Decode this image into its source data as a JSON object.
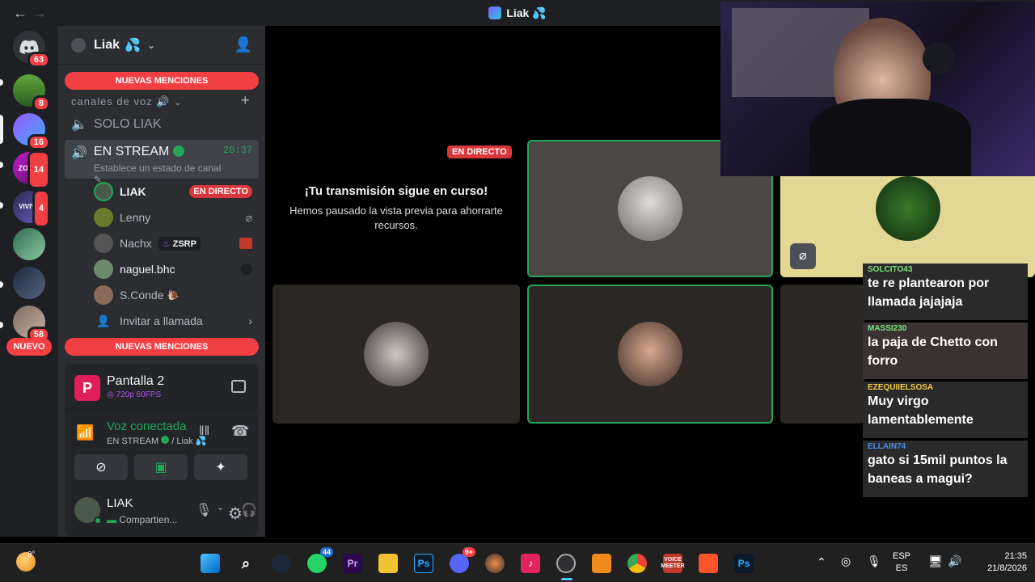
{
  "window": {
    "title": "Liak",
    "title_emoji": "💦"
  },
  "rail": {
    "home_badge": "63",
    "servers": [
      {
        "badge": "8"
      },
      {
        "badge": "16"
      },
      {
        "badge": "14",
        "label": "ZOOM"
      },
      {
        "badge": "4",
        "label": "VIVIVA"
      },
      {
        "badge": ""
      },
      {
        "badge": ""
      },
      {
        "badge": "58"
      }
    ],
    "new_pill": "NUEVO"
  },
  "server": {
    "name": "Liak",
    "name_emoji": "💦"
  },
  "channels": {
    "mentions_top": "NUEVAS MENCIONES",
    "mentions_bottom": "NUEVAS MENCIONES",
    "voice_category": "canales de voz",
    "solo_channel": "SOLO LIAK",
    "stream_channel": "EN STREAM",
    "stream_time": "28:37",
    "stream_status": "Establece un estado de canal",
    "users": [
      {
        "name": "LIAK",
        "badge": "EN DIRECTO"
      },
      {
        "name": "Lenny"
      },
      {
        "name": "Nachx",
        "tag": "ZSRP"
      },
      {
        "name": "naguel.bhc"
      },
      {
        "name": "S.Conde"
      }
    ],
    "invite": "Invitar a llamada"
  },
  "screen_share": {
    "title": "Pantalla 2",
    "quality": "720p 60FPS"
  },
  "voice": {
    "status": "Voz conectada",
    "channel": "EN STREAM",
    "server": "/ Liak"
  },
  "me": {
    "name": "LIAK",
    "status": "Compartien..."
  },
  "stage": {
    "live_label": "EN DIRECTO",
    "paused_title": "¡Tu transmisión sigue en curso!",
    "paused_body": "Hemos pausado la vista previa para ahorrarte recursos."
  },
  "chat": [
    {
      "name": "SOLCITO43",
      "color": "#7ee07e",
      "text": "te re plantearon por llamada jajajaja"
    },
    {
      "name": "MASSI230",
      "color": "#7ee07e",
      "text": "la paja de Chetto con forro"
    },
    {
      "name": "EZEQUIIELSOSA",
      "color": "#f0c94a",
      "text": "Muy virgo lamentablemente"
    },
    {
      "name": "ELLAIN74",
      "color": "#4a8fe8",
      "text": "gato si 15mil puntos la baneas a magui?"
    }
  ],
  "taskbar": {
    "weather": "8°",
    "whatsapp_badge": "44",
    "discord_badge": "9+",
    "lang_top": "ESP",
    "lang_bottom": "ES",
    "time": "21:35",
    "date": "21/8/2026"
  },
  "colors": {
    "accent_live": "#da373c",
    "connected": "#23a55a",
    "mention": "#f23f43"
  }
}
